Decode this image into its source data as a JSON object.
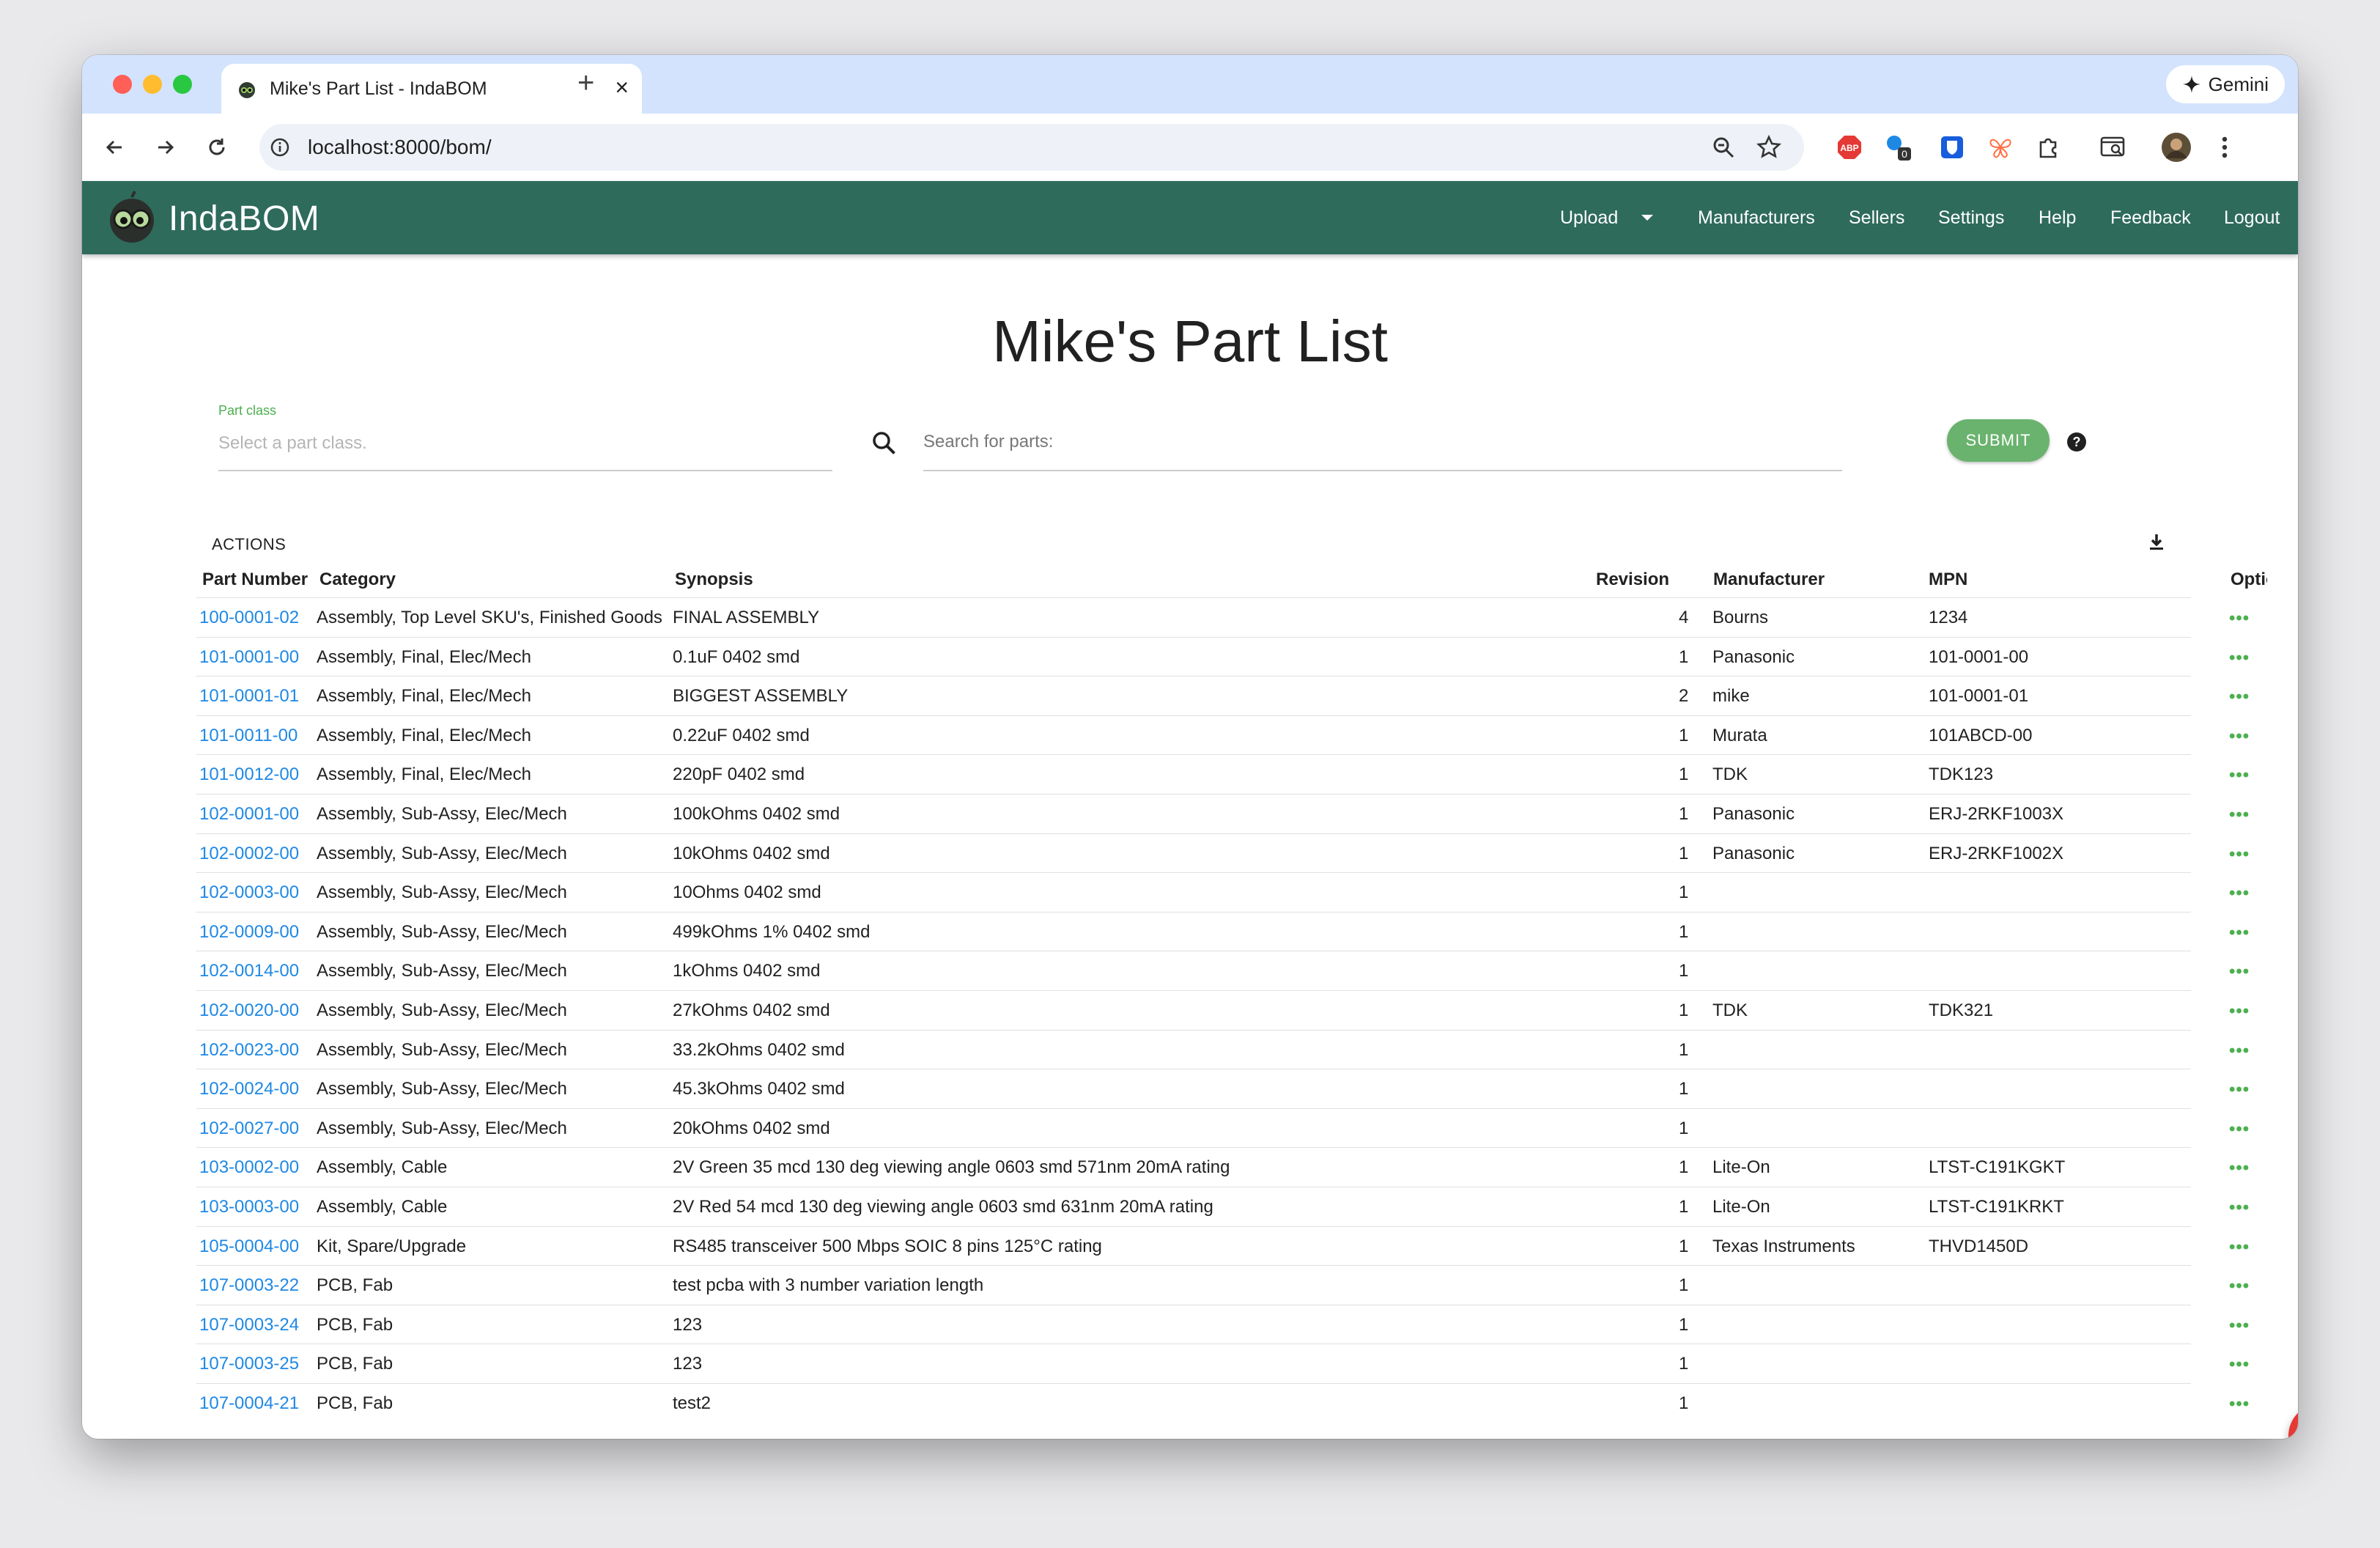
{
  "browser": {
    "tab_title": "Mike's Part List - IndaBOM",
    "url": "localhost:8000/bom/",
    "gemini_label": "Gemini",
    "extension_badge": "0"
  },
  "app": {
    "brand": "IndaBOM",
    "nav": [
      "Upload",
      "Manufacturers",
      "Sellers",
      "Settings",
      "Help",
      "Feedback",
      "Logout"
    ]
  },
  "page": {
    "title": "Mike's Part List",
    "part_class_label": "Part class",
    "part_class_placeholder": "Select a part class.",
    "search_placeholder": "Search for parts:",
    "submit_label": "SUBMIT",
    "actions_label": "ACTIONS"
  },
  "table": {
    "columns": [
      "Part Number",
      "Category",
      "Synopsis",
      "Revision",
      "Manufacturer",
      "MPN",
      "Options"
    ],
    "rows": [
      [
        "100-0001-02",
        "Assembly, Top Level SKU's, Finished Goods",
        "FINAL ASSEMBLY",
        "4",
        "Bourns",
        "1234"
      ],
      [
        "101-0001-00",
        "Assembly, Final, Elec/Mech",
        "0.1uF 0402 smd",
        "1",
        "Panasonic",
        "101-0001-00"
      ],
      [
        "101-0001-01",
        "Assembly, Final, Elec/Mech",
        "BIGGEST ASSEMBLY",
        "2",
        "mike",
        "101-0001-01"
      ],
      [
        "101-0011-00",
        "Assembly, Final, Elec/Mech",
        "0.22uF 0402 smd",
        "1",
        "Murata",
        "101ABCD-00"
      ],
      [
        "101-0012-00",
        "Assembly, Final, Elec/Mech",
        "220pF 0402 smd",
        "1",
        "TDK",
        "TDK123"
      ],
      [
        "102-0001-00",
        "Assembly, Sub-Assy, Elec/Mech",
        "100kOhms 0402 smd",
        "1",
        "Panasonic",
        "ERJ-2RKF1003X"
      ],
      [
        "102-0002-00",
        "Assembly, Sub-Assy, Elec/Mech",
        "10kOhms 0402 smd",
        "1",
        "Panasonic",
        "ERJ-2RKF1002X"
      ],
      [
        "102-0003-00",
        "Assembly, Sub-Assy, Elec/Mech",
        "10Ohms 0402 smd",
        "1",
        "",
        ""
      ],
      [
        "102-0009-00",
        "Assembly, Sub-Assy, Elec/Mech",
        "499kOhms 1% 0402 smd",
        "1",
        "",
        ""
      ],
      [
        "102-0014-00",
        "Assembly, Sub-Assy, Elec/Mech",
        "1kOhms 0402 smd",
        "1",
        "",
        ""
      ],
      [
        "102-0020-00",
        "Assembly, Sub-Assy, Elec/Mech",
        "27kOhms 0402 smd",
        "1",
        "TDK",
        "TDK321"
      ],
      [
        "102-0023-00",
        "Assembly, Sub-Assy, Elec/Mech",
        "33.2kOhms 0402 smd",
        "1",
        "",
        ""
      ],
      [
        "102-0024-00",
        "Assembly, Sub-Assy, Elec/Mech",
        "45.3kOhms 0402 smd",
        "1",
        "",
        ""
      ],
      [
        "102-0027-00",
        "Assembly, Sub-Assy, Elec/Mech",
        "20kOhms 0402 smd",
        "1",
        "",
        ""
      ],
      [
        "103-0002-00",
        "Assembly, Cable",
        "2V Green 35 mcd 130 deg viewing angle 0603 smd 571nm 20mA rating",
        "1",
        "Lite-On",
        "LTST-C191KGKT"
      ],
      [
        "103-0003-00",
        "Assembly, Cable",
        "2V Red 54 mcd 130 deg viewing angle 0603 smd 631nm 20mA rating",
        "1",
        "Lite-On",
        "LTST-C191KRKT"
      ],
      [
        "105-0004-00",
        "Kit, Spare/Upgrade",
        "RS485 transceiver 500 Mbps SOIC 8 pins 125°C rating",
        "1",
        "Texas Instruments",
        "THVD1450D"
      ],
      [
        "107-0003-22",
        "PCB, Fab",
        "test pcba with 3 number variation length",
        "1",
        "",
        ""
      ],
      [
        "107-0003-24",
        "PCB, Fab",
        "123",
        "1",
        "",
        ""
      ],
      [
        "107-0003-25",
        "PCB, Fab",
        "123",
        "1",
        "",
        ""
      ],
      [
        "107-0004-21",
        "PCB, Fab",
        "test2",
        "1",
        "",
        ""
      ]
    ],
    "row_action_label": "•••"
  },
  "fab_label": "+",
  "colors": {
    "appbar": "#2e6b5b",
    "link": "#1e88e5",
    "submit": "#6ab36e",
    "fab": "#e53935"
  }
}
